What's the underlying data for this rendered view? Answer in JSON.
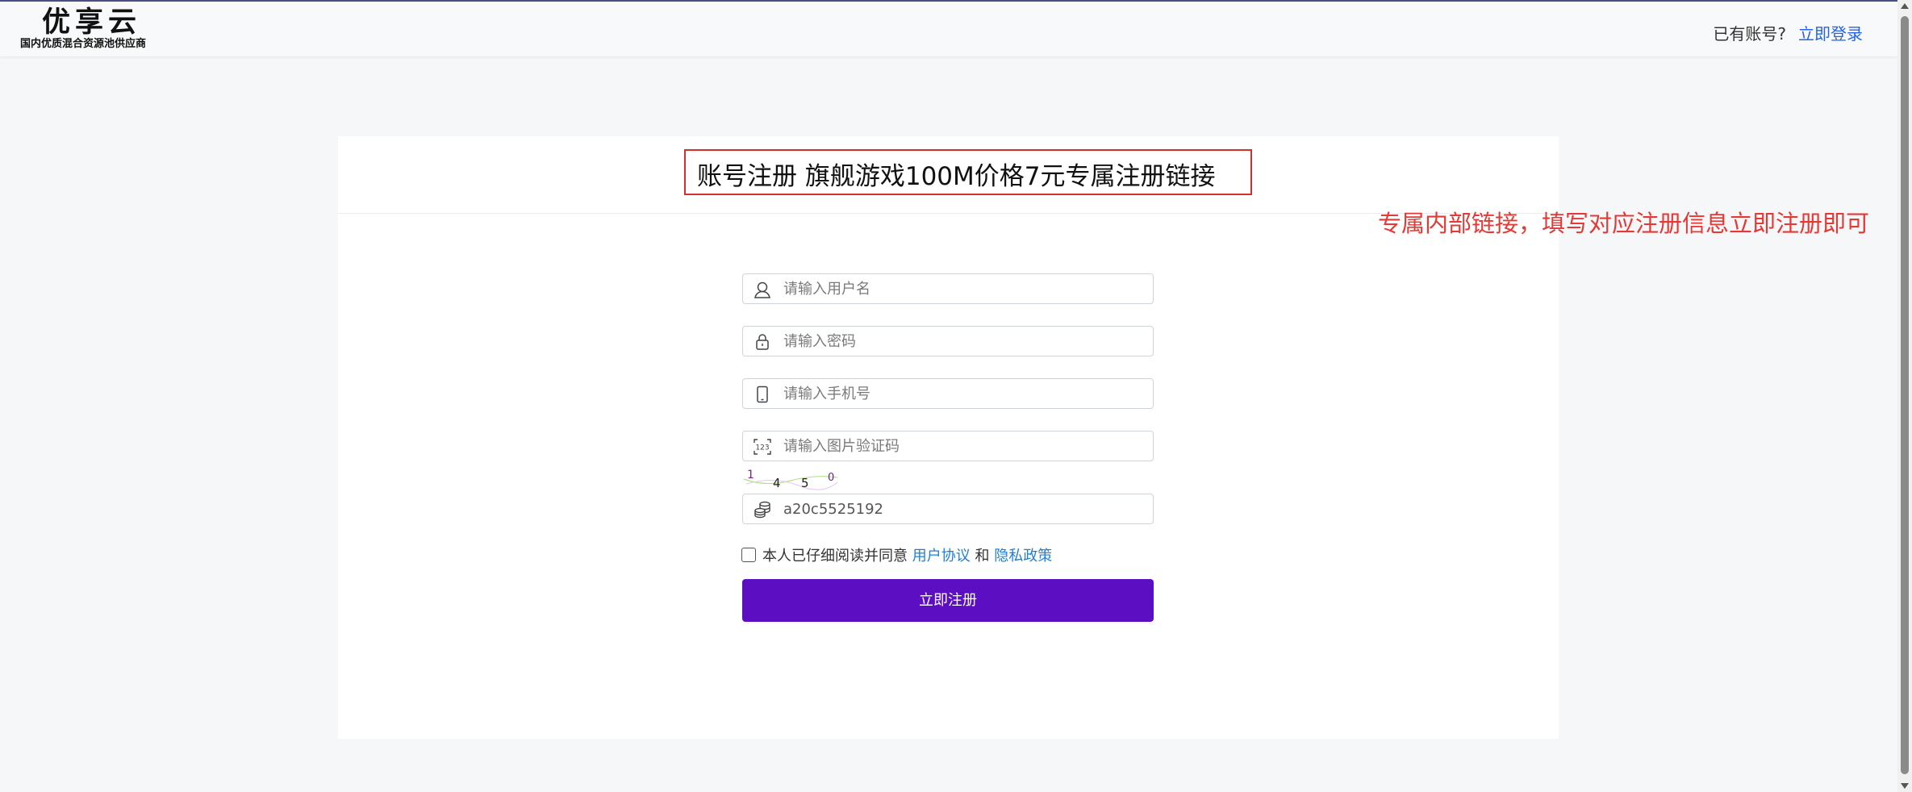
{
  "header": {
    "logo_title": "优享云",
    "logo_subtitle": "国内优质混合资源池供应商",
    "have_account_text": "已有账号?",
    "login_link": "立即登录"
  },
  "page": {
    "title": "账号注册 旗舰游戏100M价格7元专属注册链接",
    "annotation": "专属内部链接，填写对应注册信息立即注册即可",
    "annotation_color": "#e53935"
  },
  "form": {
    "username": {
      "placeholder": "请输入用户名",
      "value": "",
      "icon": "user-icon"
    },
    "password": {
      "placeholder": "请输入密码",
      "value": "",
      "icon": "lock-icon"
    },
    "phone": {
      "placeholder": "请输入手机号",
      "value": "",
      "icon": "mobile-phone-icon"
    },
    "captcha": {
      "placeholder": "请输入图片验证码",
      "value": "",
      "icon": "captcha-123-icon"
    },
    "captcha_image_text": [
      "1",
      "4",
      "5",
      "0"
    ],
    "invite_code": {
      "value": "a20c5525192",
      "icon": "coins-icon"
    },
    "agree": {
      "checked": false,
      "text": "本人已仔细阅读并同意",
      "user_agreement": "用户协议",
      "and": "和",
      "privacy_policy": "隐私政策"
    },
    "submit_label": "立即注册",
    "submit_color": "#5b0ec2"
  }
}
